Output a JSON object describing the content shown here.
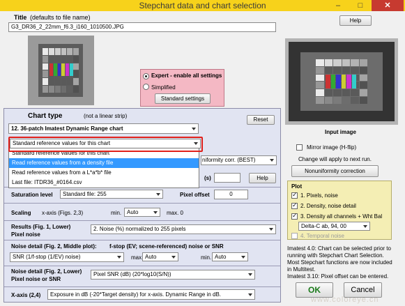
{
  "window": {
    "title": "Stepchart data and chart selection",
    "minimize": "–",
    "restore": "□",
    "close": "✕"
  },
  "header": {
    "title_label": "Title",
    "title_hint": "(defaults to file name)",
    "title_value": "G3_DR36_2_22mm_f6.3_i160_1010500.JPG",
    "help_label": "Help"
  },
  "mode": {
    "expert_label": "Expert - enable all settings",
    "simplified_label": "Simplified",
    "selected": "expert",
    "standard_settings_label": "Standard settings"
  },
  "chart_type": {
    "label": "Chart type",
    "hint": "(not a linear strip)",
    "value": "12. 36-patch Imatest Dynamic Range chart",
    "reset_label": "Reset"
  },
  "reference": {
    "selected": "Standard reference values for this chart",
    "options": [
      "Standard reference values for this chart",
      "Read reference values from a density file",
      "Read reference values from a L*a*b* file",
      "Last file: ITDR36_#0164.csv"
    ],
    "highlighted_index": 1,
    "uniformity_value": "niformity corr. (BEST)",
    "partial_label": "(s)",
    "help_label": "Help"
  },
  "saturation": {
    "label": "Saturation level",
    "value": "Standard file:  255",
    "pixel_offset_label": "Pixel offset",
    "pixel_offset_value": "0"
  },
  "scaling": {
    "label": "Scaling",
    "xaxis_label": "x-axis (Figs. 2,3)",
    "min_label": "min.",
    "min_value": "Auto",
    "max_label": "max. 0"
  },
  "results": {
    "label": "Results (Fig. 1, Lower)",
    "sublabel": "Pixel noise",
    "value": "2. Noise (%) normalized to 255 pixels"
  },
  "noise_detail": {
    "label": "Noise detail (Fig. 2, Middle plot):",
    "desc": "f-stop (EV; scene-referenced) noise or SNR",
    "value": "SNR (1/f-stop (1/EV) noise)",
    "max_label": "max.",
    "max_value": "Auto",
    "min_label": "min.",
    "min_value": "Auto"
  },
  "noise_detail2": {
    "label": "Noise detail (Fig. 2, Lower)",
    "sublabel": "Pixel noise or SNR",
    "value": "Pixel SNR (dB)  (20*log10(S/N))"
  },
  "xaxis": {
    "label": "X-axis (2,4)",
    "value": "Exposure in dB (-20*Target density) for x-axis.  Dynamic Range in dB."
  },
  "input_image": {
    "caption": "Input image",
    "mirror_label": "Mirror image (H-flip)",
    "mirror_checked": false,
    "change_note": "Change will apply to next run.",
    "nonuniformity_label": "Nonuniformity correction"
  },
  "plot": {
    "title": "Plot",
    "items": [
      {
        "label": "1. Pixels, noise",
        "checked": true
      },
      {
        "label": "2. Density, noise detail",
        "checked": true
      },
      {
        "label": "3. Density all channels + Wht Bal",
        "checked": true
      }
    ],
    "delta_value": "Delta-C ab, 94, 00",
    "temporal_label": "4. Temporal noise",
    "temporal_checked": false
  },
  "notes": {
    "lines": [
      "Imatest 4.0: Chart can be selected prior to",
      "running with Stepchart Chart Selection.",
      "Most Stepchart functions are now included",
      "in Multitest.",
      "Imatest 3.10: Pixel offset can be entered."
    ]
  },
  "actions": {
    "ok_label": "OK",
    "cancel_label": "Cancel"
  },
  "watermark": "www.coloreye.cn",
  "colors": {
    "titlebar": "#f7d21b",
    "close": "#c73a30",
    "expert_box": "#f4b8c4",
    "left_panel": "#e1e4f2",
    "plot_panel": "#f4eeb4",
    "highlight": "#3399ff",
    "annotation_box": "#e0201a",
    "ok_text": "#1a7a1a"
  }
}
